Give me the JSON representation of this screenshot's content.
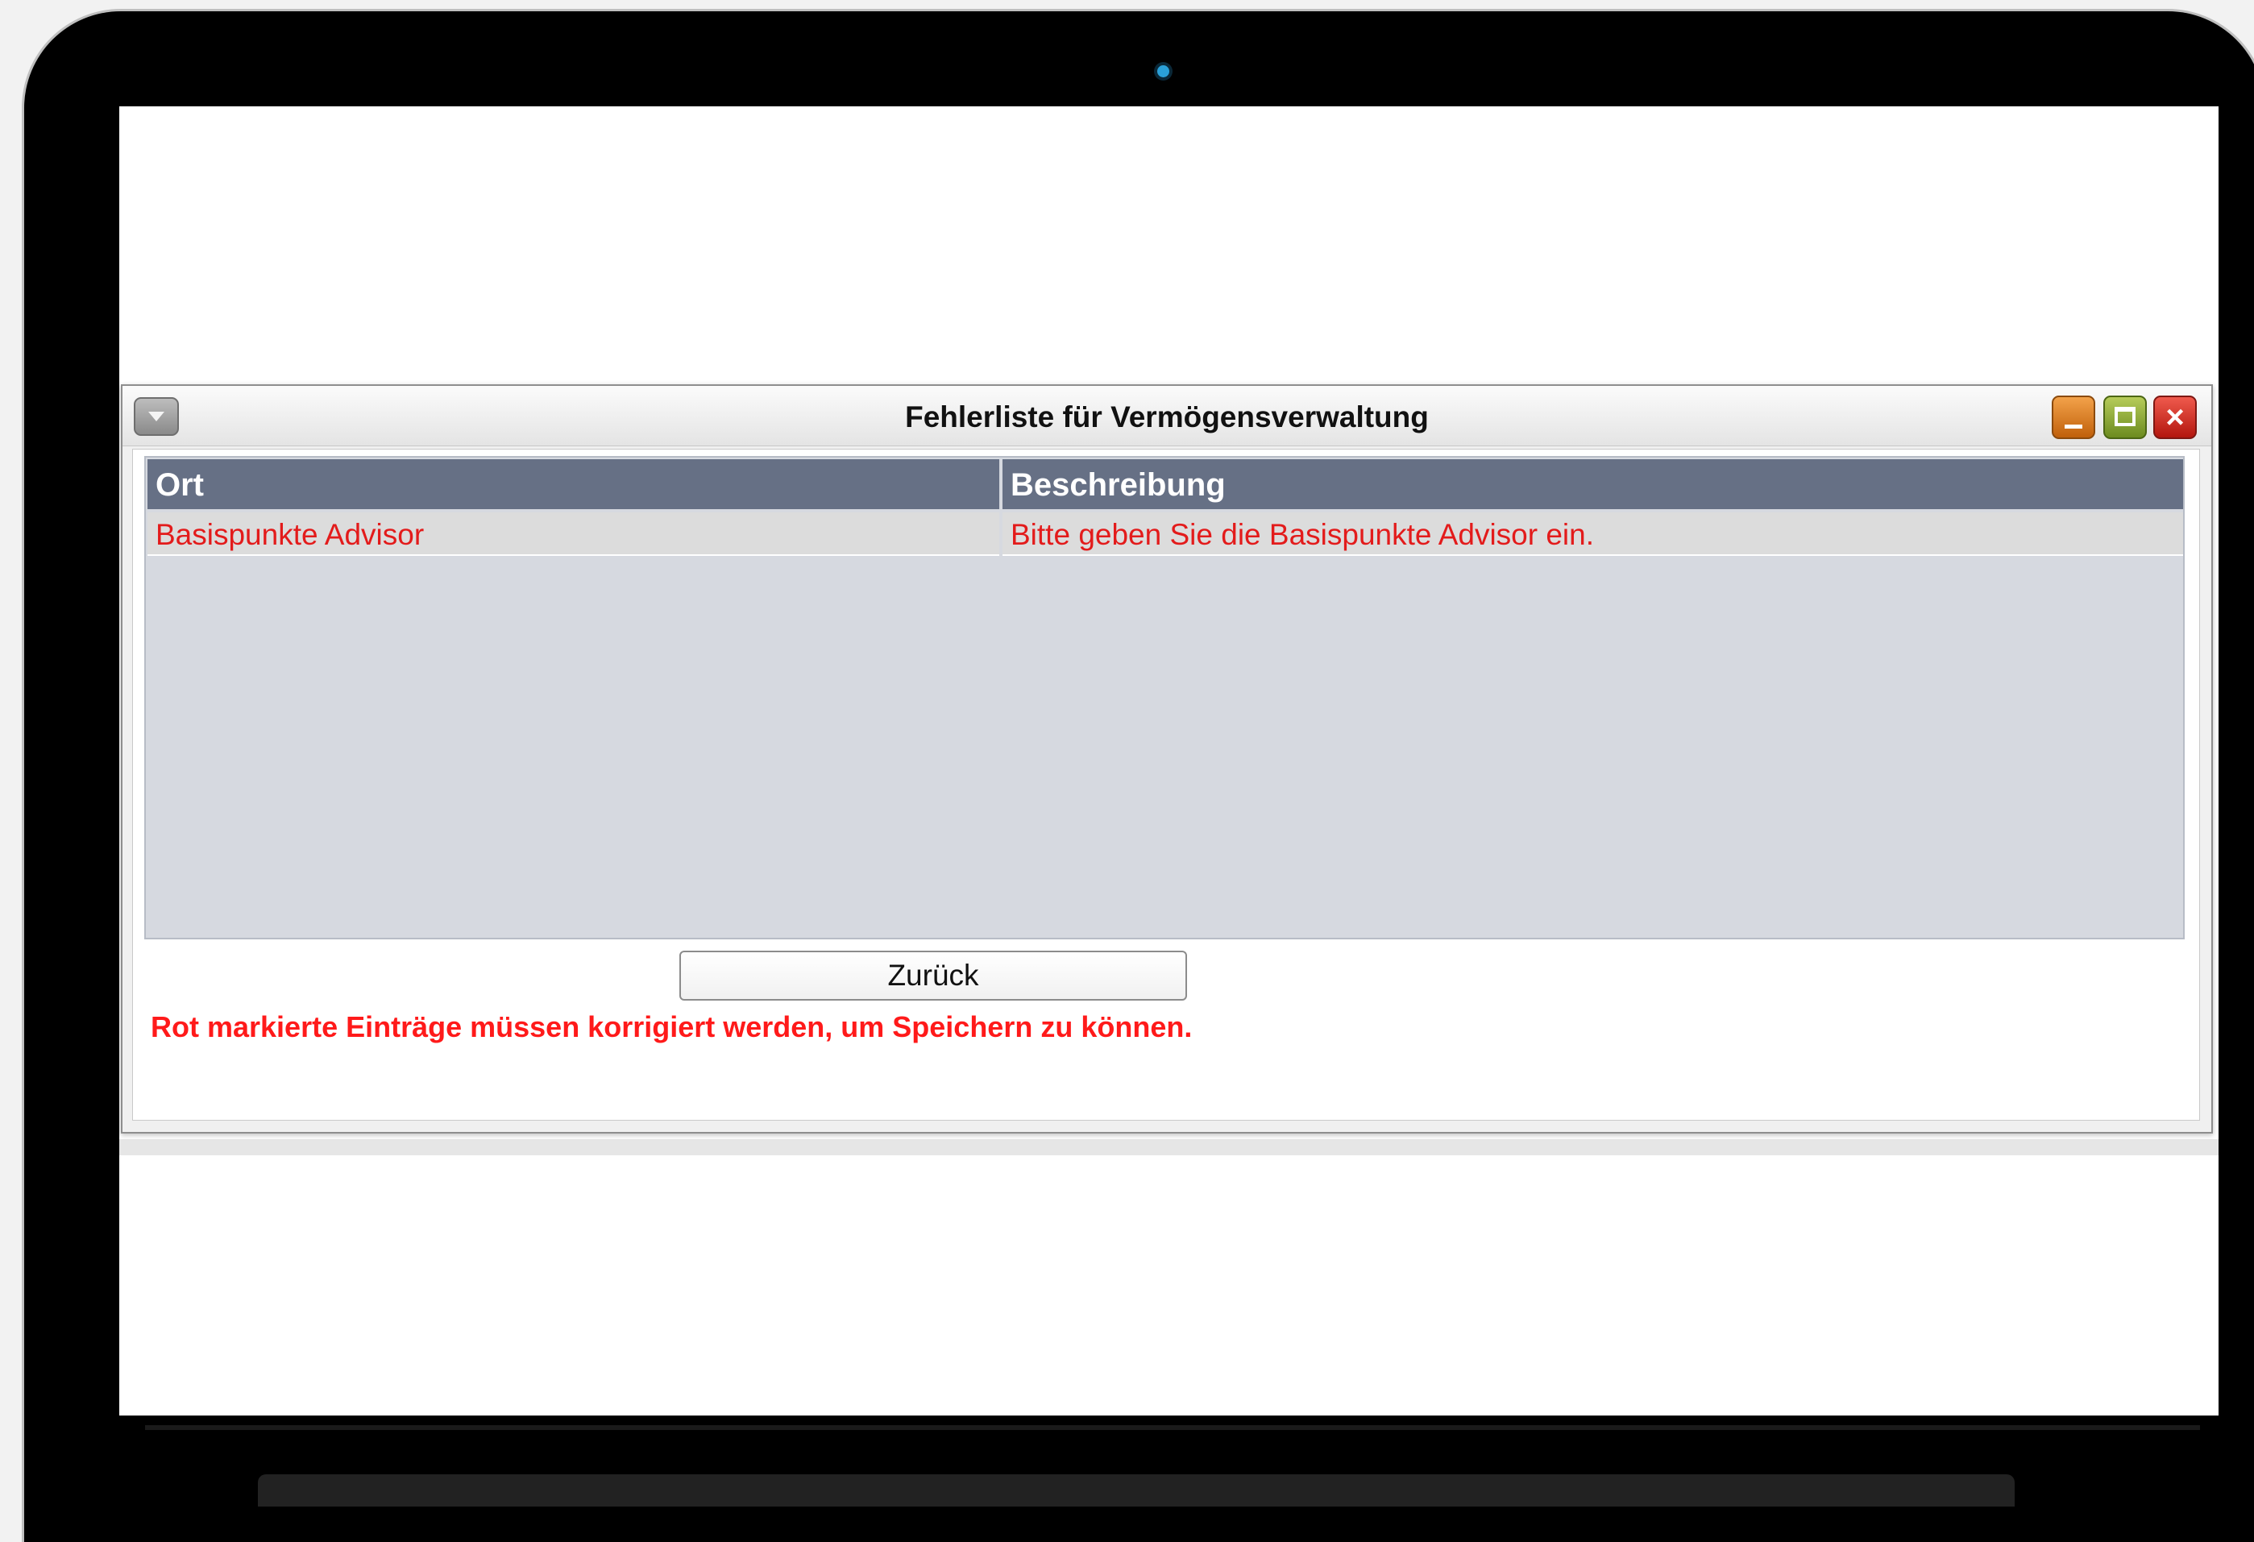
{
  "dialog": {
    "title": "Fehlerliste für Vermögensverwaltung",
    "columns": [
      "Ort",
      "Beschreibung"
    ],
    "rows": [
      {
        "ort": "Basispunkte Advisor",
        "beschreibung": "Bitte geben Sie die Basispunkte Advisor ein."
      }
    ],
    "back_label": "Zurück",
    "error_message": "Rot markierte Einträge müssen korrigiert werden, um Speichern zu können."
  },
  "icons": {
    "menu": "chevron-down-icon",
    "minimize": "minimize-icon",
    "maximize": "maximize-icon",
    "close": "close-icon"
  },
  "colors": {
    "header_bg": "#667085",
    "error_text": "#e31b1b",
    "minimize": "#e07f1f",
    "maximize": "#8aa632",
    "close": "#d32f26"
  }
}
